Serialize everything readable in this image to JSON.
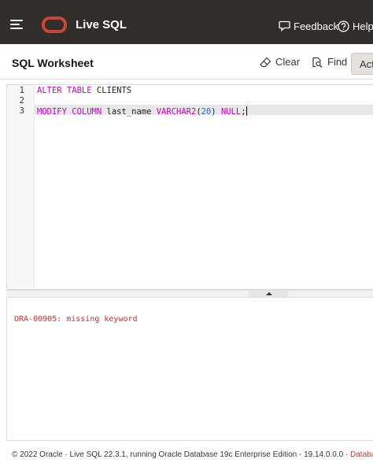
{
  "header": {
    "app_title": "Live SQL",
    "feedback_label": "Feedback",
    "help_label": "Help",
    "brand_color": "#c74634",
    "bar_color": "#312d2a"
  },
  "toolbar": {
    "title": "SQL Worksheet",
    "clear_label": "Clear",
    "find_label": "Find",
    "actions_label": "Actions"
  },
  "editor": {
    "line_numbers": [
      "1",
      "2",
      "3"
    ],
    "lines": [
      {
        "kw1": "ALTER TABLE",
        "text": " CLIENTS"
      },
      {
        "text": ""
      },
      {
        "kw1": "MODIFY COLUMN",
        "text": " last_name ",
        "kw2": "VARCHAR2",
        "p1": "(",
        "num": "20",
        "p2": ") ",
        "kw3": "NULL",
        "end": ";"
      }
    ]
  },
  "output": {
    "error": "ORA-00905: missing keyword"
  },
  "footer": {
    "text": "© 2022 Oracle · Live SQL 22.3.1, running Oracle Database 19c Enterprise Edition - 19.14.0.0.0 · ",
    "link": "Database Documentation"
  }
}
